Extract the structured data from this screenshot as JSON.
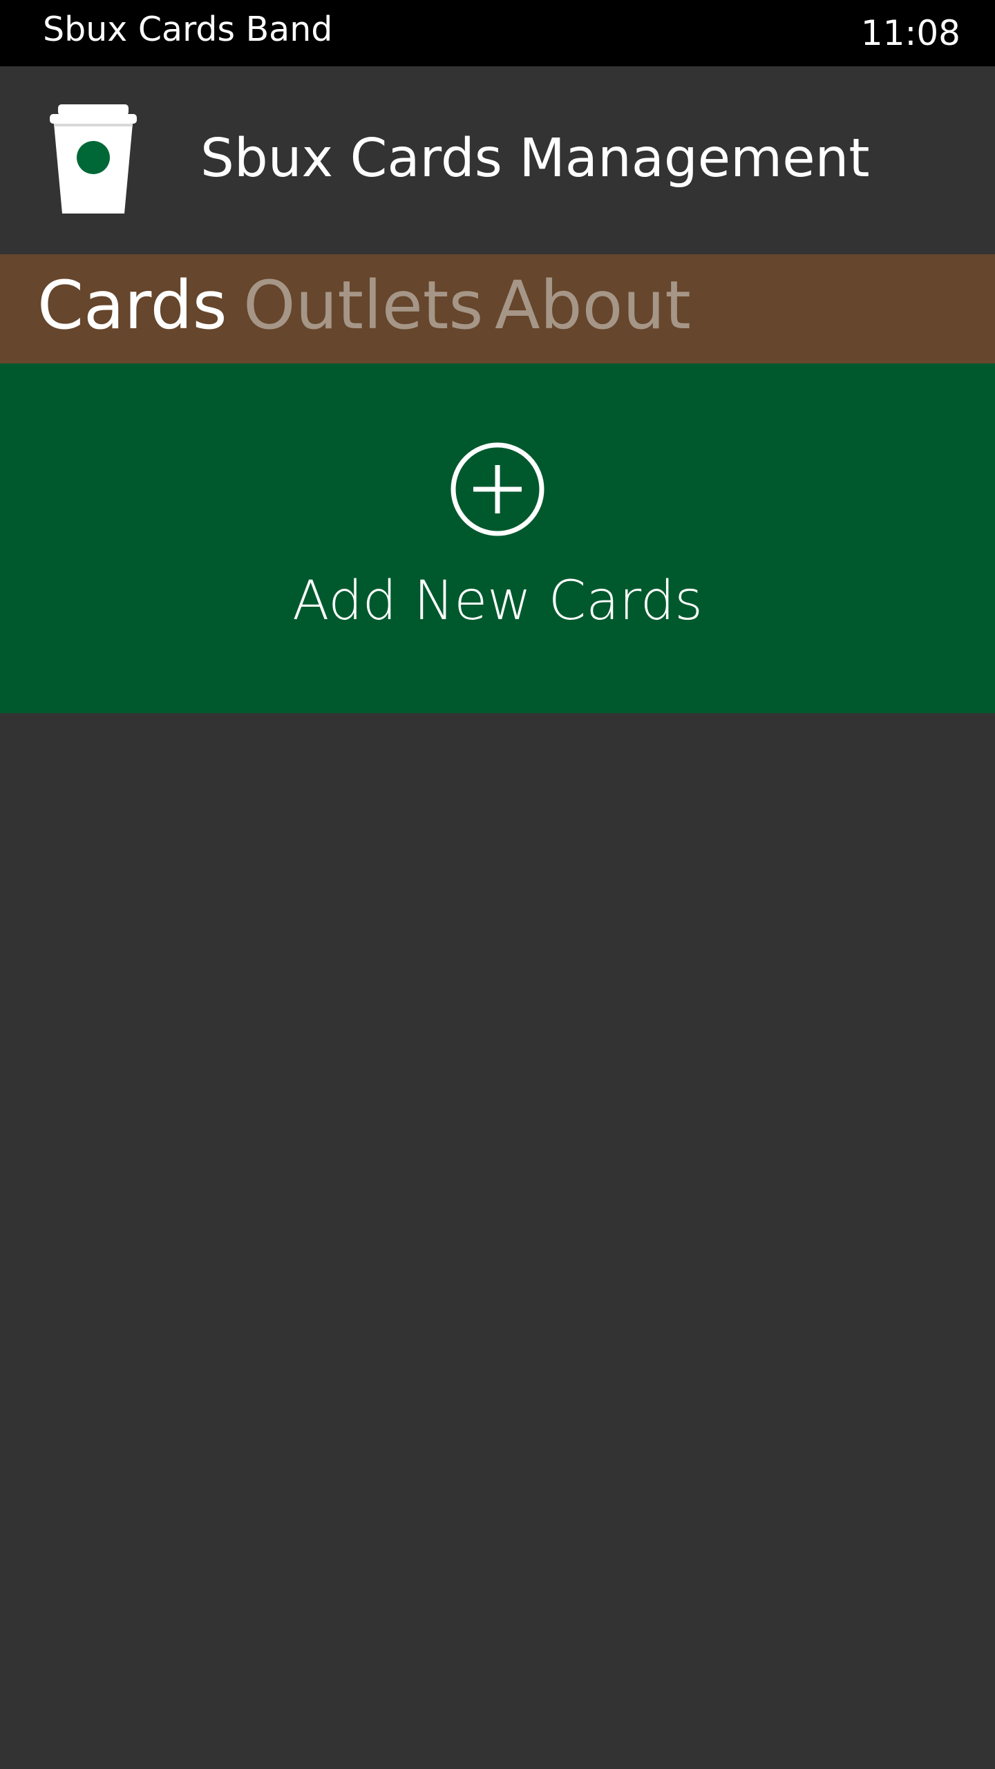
{
  "status_bar": {
    "app_name": "Sbux Cards Band",
    "time": "11:08"
  },
  "header": {
    "logo_icon": "coffee-cup-icon",
    "title": "Sbux Cards Management"
  },
  "pivot": {
    "tabs": [
      {
        "label": "Cards",
        "active": true
      },
      {
        "label": "Outlets",
        "active": false
      },
      {
        "label": "About",
        "active": false
      }
    ]
  },
  "add_card": {
    "icon": "add-circle-icon",
    "label": "Add New Cards"
  },
  "colors": {
    "status_bar": "#000000",
    "background": "#333333",
    "pivot_bar": "#66462c",
    "pivot_inactive_text": "#a69687",
    "accent_green": "#00592d",
    "text": "#ffffff"
  }
}
